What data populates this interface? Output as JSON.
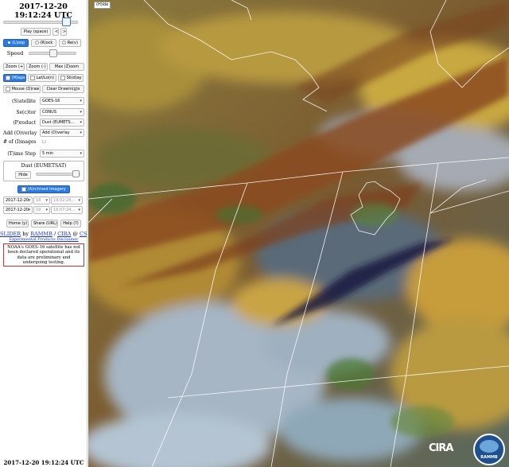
{
  "header": {
    "date": "2017-12-20",
    "time": "19:12:24 UTC"
  },
  "controls": {
    "play": "Play (space)",
    "prev": "<",
    "next": ">",
    "loop": "(L)oop",
    "rock": "(R)ock",
    "rev": "Re(v)",
    "speed": "Speed",
    "zoom_in": "Zoom (+)",
    "zoom_out": "Zoom (-)",
    "max_zoom": "Max (Z)oom",
    "maps": "(M)aps",
    "latlon": "Lat/Lo(n)",
    "slider": "Sli(d)ay",
    "mouse_draw": "Mouse (D)raw",
    "clear_drawing": "Clear Drawin(g)s"
  },
  "settings": {
    "satellite_label": "(S)atellite",
    "satellite_value": "GOES-16",
    "sector_label": "Se(c)tor",
    "sector_value": "CONUS",
    "product_label": "(P)roduct",
    "product_value": "Dust (EUMETS…",
    "overlay_label": "Add (O)verlay",
    "overlay_value": "Add (O)verlay",
    "num_images_label": "# of (I)mages",
    "num_images_value": "12",
    "timestep_label": "(T)ime Step",
    "timestep_value": "5 min"
  },
  "product_box": {
    "title": "Dust (EUMETSAT)",
    "hide": "Hide"
  },
  "archive": {
    "button": "(A)rchived Imagery",
    "rows": [
      {
        "date": "2017-12-20",
        "hour": "18",
        "time": "19:02:24…"
      },
      {
        "date": "2017-12-20",
        "hour": "19",
        "time": "19:57:24…"
      }
    ]
  },
  "footer_buttons": {
    "home": "Home (y)",
    "share": "Share (URL)",
    "help": "Help (?)"
  },
  "credits": {
    "slider": "SLIDER",
    "by": "by",
    "rammb": "RAMMB",
    "sep": "/",
    "cira": "CIRA",
    "at": "@",
    "csu": "CSU",
    "disclaimer": "Experimental Products Disclaimer"
  },
  "notice": "NOAA's GOES-16 satellite has not been declared operational and its data are preliminary and undergoing testing.",
  "viewer": {
    "hide_tag": "(H)ide",
    "cira_logo": "CIRA",
    "rammb_logo": "RAMMB"
  },
  "bottom_date": "2017-12-20 19:12:24 UTC",
  "colors": {
    "accent": "#2a7ae2",
    "notice_border": "#cc3333",
    "link": "#1a37c8"
  }
}
